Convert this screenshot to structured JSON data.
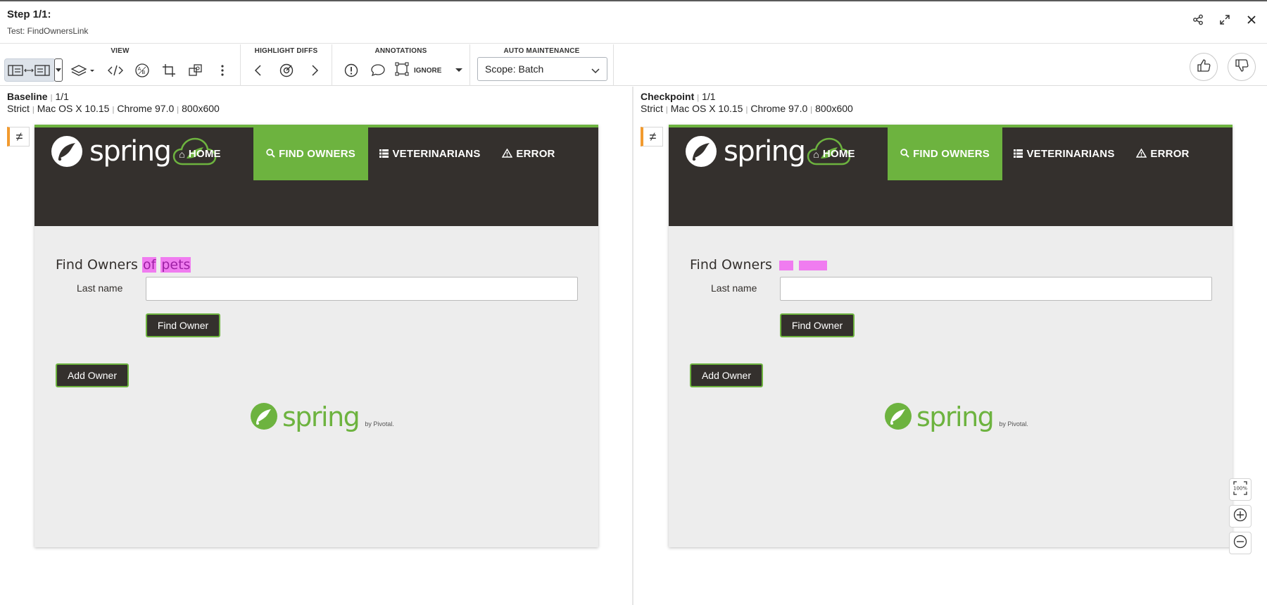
{
  "header": {
    "step_title": "Step 1/1:",
    "test_name": "Test: FindOwnersLink",
    "icons": [
      "share-icon",
      "expand-icon",
      "close-icon"
    ]
  },
  "toolbar": {
    "view_label": "VIEW",
    "highlight_label": "HIGHLIGHT DIFFS",
    "annotations_label": "ANNOTATIONS",
    "auto_label": "AUTO MAINTENANCE",
    "ignore_label": "IGNORE",
    "scope_value": "Scope: Batch",
    "view_icons": [
      "side-by-side-icon",
      "layers-icon",
      "code-icon",
      "ab-icon",
      "crop-icon",
      "regions-icon",
      "more-icon"
    ],
    "highlight_icons": [
      "prev-icon",
      "target-icon",
      "next-icon"
    ],
    "annotation_icons": [
      "alert-icon",
      "comment-icon",
      "region-icon"
    ],
    "thumb_icons": [
      "thumbs-up-icon",
      "thumbs-down-icon"
    ]
  },
  "baseline": {
    "title": "Baseline",
    "count": "1/1",
    "match": "Strict",
    "os": "Mac OS X 10.15",
    "browser": "Chrome 97.0",
    "viewport": "800x600",
    "diff_symbol": "≠"
  },
  "checkpoint": {
    "title": "Checkpoint",
    "count": "1/1",
    "match": "Strict",
    "os": "Mac OS X 10.15",
    "browser": "Chrome 97.0",
    "viewport": "800x600",
    "diff_symbol": "≠"
  },
  "app": {
    "logo_text": "spring",
    "nav": {
      "home": "HOME",
      "find": "FIND OWNERS",
      "vets": "VETERINARIANS",
      "error": "ERROR"
    },
    "heading": "Find Owners",
    "heading_extra": "of pets",
    "heading_extra_words": [
      "of",
      "pets"
    ],
    "last_name_label": "Last name",
    "find_button": "Find Owner",
    "add_button": "Add Owner",
    "footer_word": "spring",
    "footer_sub": "by Pivotal."
  },
  "zoom": {
    "fit_label": "100%"
  },
  "colors": {
    "spring_green": "#6db33f",
    "spring_dark": "#34302d",
    "diff_highlight": "#f07cf0",
    "diff_marker": "#f29a2e"
  }
}
